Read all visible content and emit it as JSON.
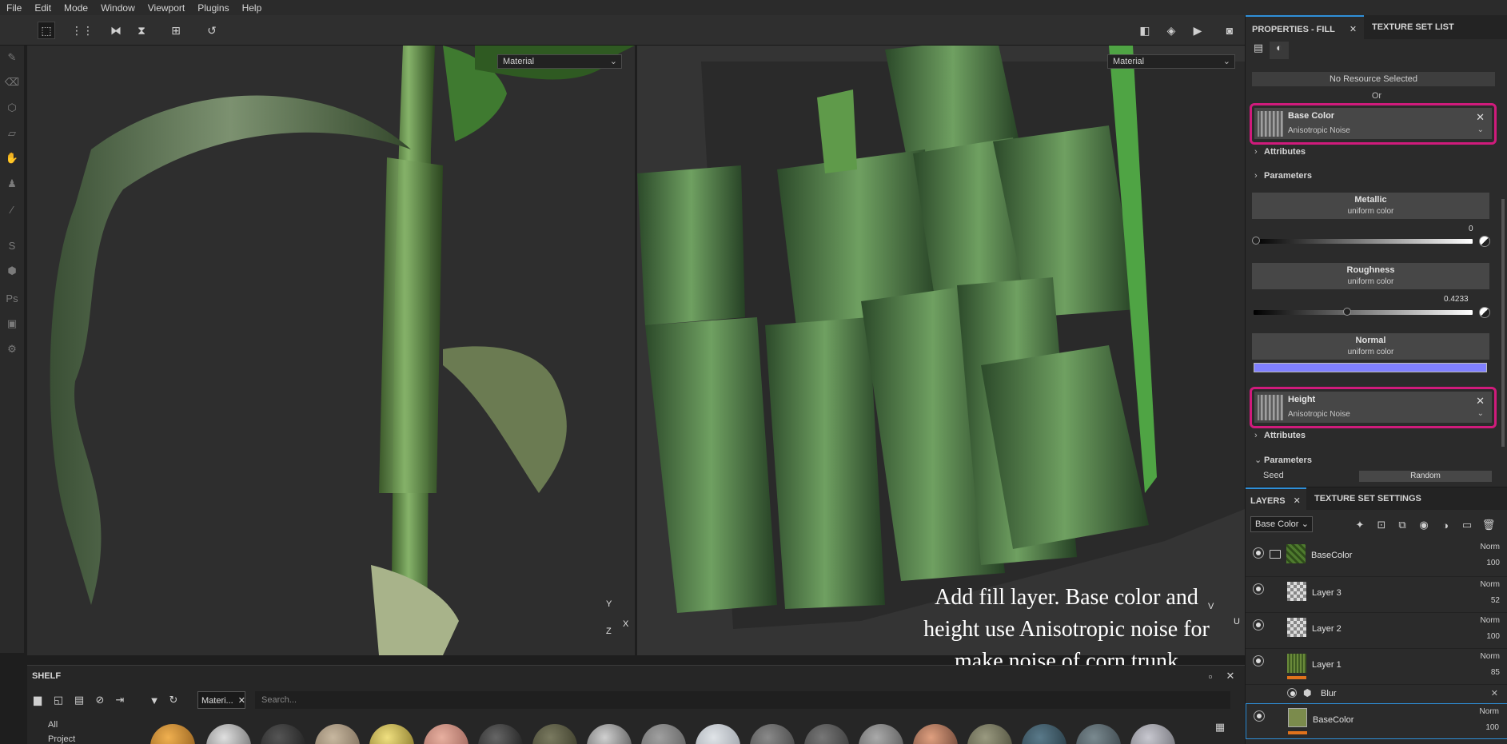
{
  "menu": [
    "File",
    "Edit",
    "Mode",
    "Window",
    "Viewport",
    "Plugins",
    "Help"
  ],
  "viewport": {
    "left_select": "Material",
    "right_select": "Material",
    "caption": "Add fill layer. Base color and height use Anisotropic noise for make noise of corn trunk",
    "axis_left": {
      "y": "Y",
      "z": "Z",
      "x": "X"
    },
    "axis_right": {
      "v": "V",
      "u": "U"
    }
  },
  "shelf": {
    "title": "SHELF",
    "tab_label": "Materi...",
    "search_placeholder": "Search...",
    "categories": [
      "All",
      "Project"
    ]
  },
  "properties": {
    "tab_active": "PROPERTIES - FILL",
    "tab_other": "TEXTURE SET LIST",
    "no_resource": "No Resource Selected",
    "or": "Or",
    "base_color": {
      "title": "Base Color",
      "sub": "Anisotropic Noise"
    },
    "attributes": "Attributes",
    "parameters": "Parameters",
    "metallic": {
      "title": "Metallic",
      "sub": "uniform color",
      "value": "0"
    },
    "roughness": {
      "title": "Roughness",
      "sub": "uniform color",
      "value": "0.4233"
    },
    "normal": {
      "title": "Normal",
      "sub": "uniform color",
      "color": "#8080ff"
    },
    "height": {
      "title": "Height",
      "sub": "Anisotropic Noise"
    },
    "attributes2": "Attributes",
    "parameters2": "Parameters",
    "seed_label": "Seed",
    "seed_button": "Random",
    "highlight_color": "#d01b7c"
  },
  "layers": {
    "tab_active": "LAYERS",
    "tab_other": "TEXTURE SET SETTINGS",
    "channel": "Base Color",
    "rows": [
      {
        "name": "BaseColor",
        "blend": "Norm",
        "opacity": "100"
      },
      {
        "name": "Layer 3",
        "blend": "Norm",
        "opacity": "52"
      },
      {
        "name": "Layer 2",
        "blend": "Norm",
        "opacity": "100"
      },
      {
        "name": "Layer 1",
        "blend": "Norm",
        "opacity": "85"
      },
      {
        "name": "Blur"
      },
      {
        "name": "BaseColor",
        "blend": "Norm",
        "opacity": "100"
      }
    ]
  }
}
